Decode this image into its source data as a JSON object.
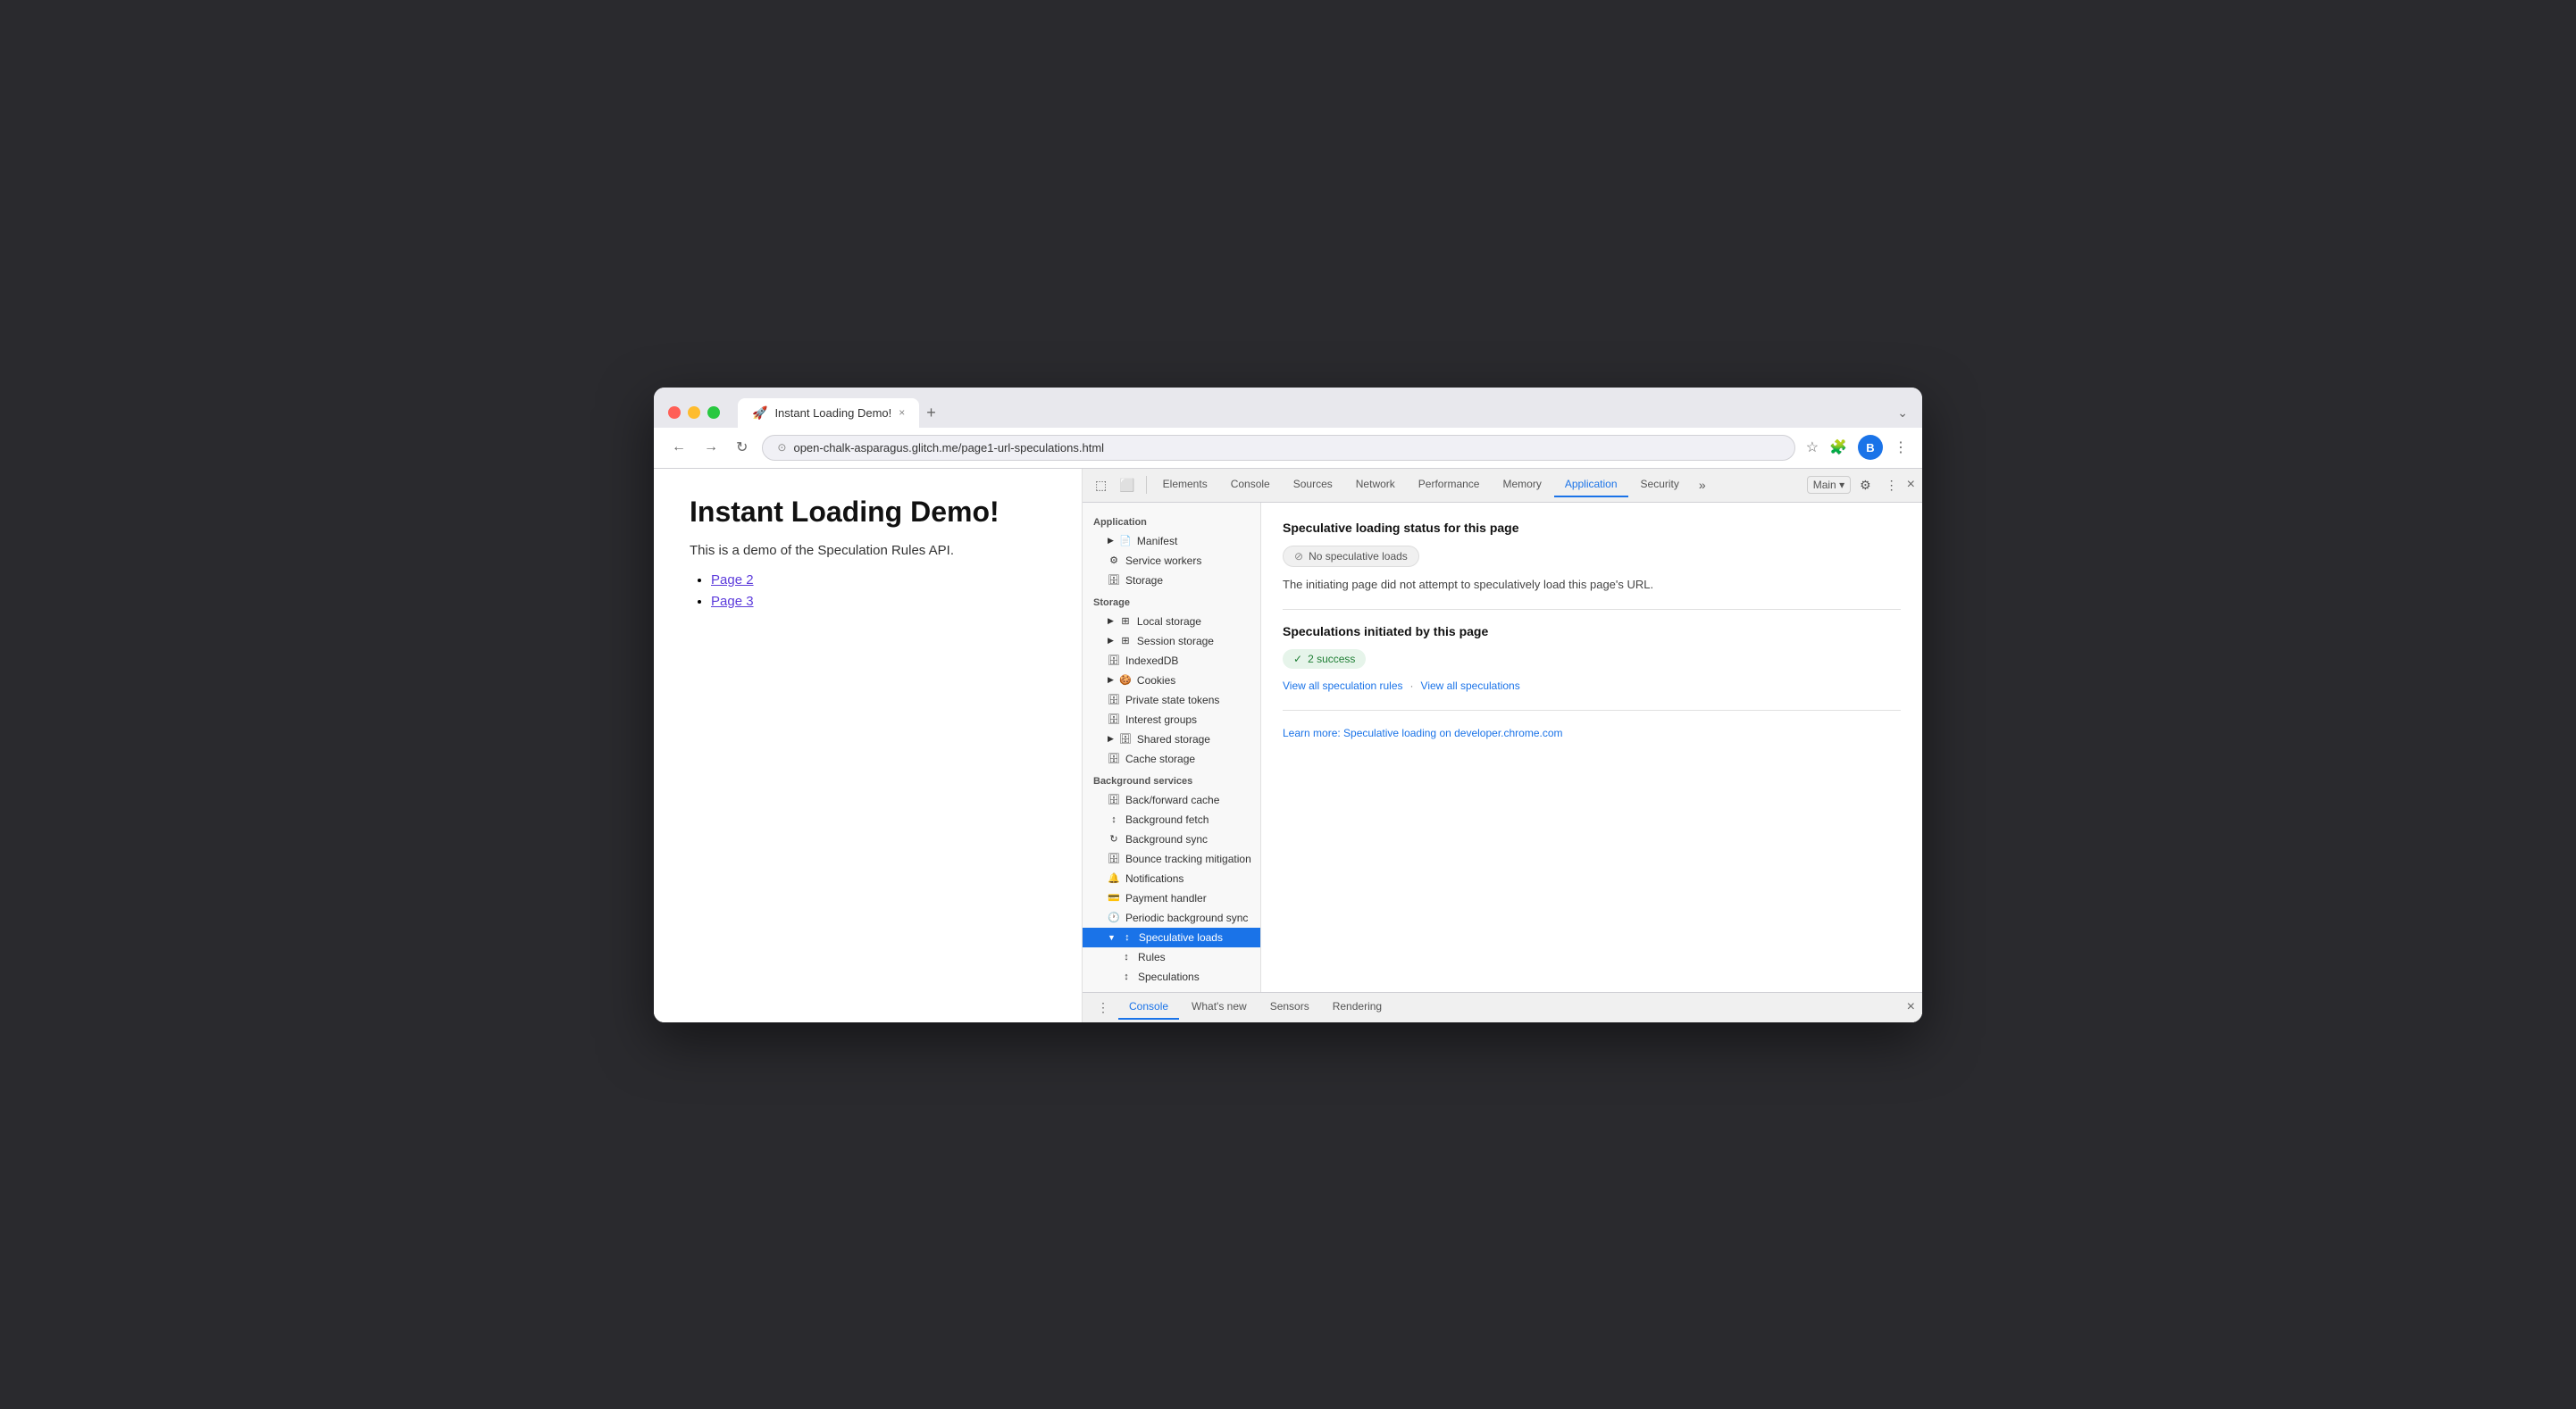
{
  "browser": {
    "tab_title": "Instant Loading Demo!",
    "tab_close": "×",
    "tab_new": "+",
    "tab_dropdown": "⌄",
    "url": "open-chalk-asparagus.glitch.me/page1-url-speculations.html",
    "nav_back": "←",
    "nav_forward": "→",
    "nav_reload": "↻",
    "security_icon": "⊙",
    "toolbar_star": "☆",
    "toolbar_extension": "🧩",
    "toolbar_profile": "👤",
    "toolbar_more": "⋮",
    "avatar_label": "B"
  },
  "webpage": {
    "title": "Instant Loading Demo!",
    "description": "This is a demo of the Speculation Rules API.",
    "links": [
      {
        "text": "Page 2",
        "href": "#"
      },
      {
        "text": "Page 3",
        "href": "#"
      }
    ]
  },
  "devtools": {
    "toolbar": {
      "inspect_icon": "⬚",
      "device_icon": "⬜",
      "tabs": [
        {
          "label": "Elements",
          "active": false
        },
        {
          "label": "Console",
          "active": false
        },
        {
          "label": "Sources",
          "active": false
        },
        {
          "label": "Network",
          "active": false
        },
        {
          "label": "Performance",
          "active": false
        },
        {
          "label": "Memory",
          "active": false
        },
        {
          "label": "Application",
          "active": true
        },
        {
          "label": "Security",
          "active": false
        }
      ],
      "more": "»",
      "context": "Main",
      "context_arrow": "▾",
      "settings_icon": "⚙",
      "more_icon": "⋮",
      "close_icon": "×"
    },
    "sidebar": {
      "application_section": "Application",
      "items_application": [
        {
          "label": "Manifest",
          "icon": "📄",
          "indent": "sub",
          "arrow": "▶"
        },
        {
          "label": "Service workers",
          "icon": "⚙",
          "indent": "sub",
          "arrow": ""
        },
        {
          "label": "Storage",
          "icon": "🗄",
          "indent": "sub",
          "arrow": ""
        }
      ],
      "storage_section": "Storage",
      "items_storage": [
        {
          "label": "Local storage",
          "icon": "⊞",
          "indent": "sub",
          "arrow": "▶"
        },
        {
          "label": "Session storage",
          "icon": "⊞",
          "indent": "sub",
          "arrow": "▶"
        },
        {
          "label": "IndexedDB",
          "icon": "🗄",
          "indent": "sub",
          "arrow": ""
        },
        {
          "label": "Cookies",
          "icon": "🍪",
          "indent": "sub",
          "arrow": "▶"
        },
        {
          "label": "Private state tokens",
          "icon": "🗄",
          "indent": "sub",
          "arrow": ""
        },
        {
          "label": "Interest groups",
          "icon": "🗄",
          "indent": "sub",
          "arrow": ""
        },
        {
          "label": "Shared storage",
          "icon": "🗄",
          "indent": "sub",
          "arrow": "▶"
        },
        {
          "label": "Cache storage",
          "icon": "🗄",
          "indent": "sub",
          "arrow": ""
        }
      ],
      "background_section": "Background services",
      "items_background": [
        {
          "label": "Back/forward cache",
          "icon": "🗄",
          "indent": "sub",
          "arrow": ""
        },
        {
          "label": "Background fetch",
          "icon": "↕",
          "indent": "sub",
          "arrow": ""
        },
        {
          "label": "Background sync",
          "icon": "↻",
          "indent": "sub",
          "arrow": ""
        },
        {
          "label": "Bounce tracking mitigation",
          "icon": "🗄",
          "indent": "sub",
          "arrow": ""
        },
        {
          "label": "Notifications",
          "icon": "🔔",
          "indent": "sub",
          "arrow": ""
        },
        {
          "label": "Payment handler",
          "icon": "💳",
          "indent": "sub",
          "arrow": ""
        },
        {
          "label": "Periodic background sync",
          "icon": "🕐",
          "indent": "sub",
          "arrow": ""
        },
        {
          "label": "Speculative loads",
          "icon": "↕",
          "indent": "sub",
          "arrow": "▼",
          "active": true
        },
        {
          "label": "Rules",
          "icon": "↕",
          "indent": "sub2",
          "arrow": ""
        },
        {
          "label": "Speculations",
          "icon": "↕",
          "indent": "sub2",
          "arrow": ""
        }
      ]
    },
    "main_panel": {
      "speculative_status_title": "Speculative loading status for this page",
      "no_loads_badge": "No speculative loads",
      "no_loads_icon": "⊘",
      "no_loads_desc": "The initiating page did not attempt to speculatively load this page's URL.",
      "speculations_title": "Speculations initiated by this page",
      "success_badge": "2 success",
      "success_icon": "✓",
      "view_rules_link": "View all speculation rules",
      "separator": "·",
      "view_speculations_link": "View all speculations",
      "learn_more_link": "Learn more: Speculative loading on developer.chrome.com"
    },
    "bottom_bar": {
      "menu_icon": "⋮",
      "tabs": [
        {
          "label": "Console",
          "active": true
        },
        {
          "label": "What's new",
          "active": false
        },
        {
          "label": "Sensors",
          "active": false
        },
        {
          "label": "Rendering",
          "active": false
        }
      ],
      "close_icon": "×"
    }
  }
}
